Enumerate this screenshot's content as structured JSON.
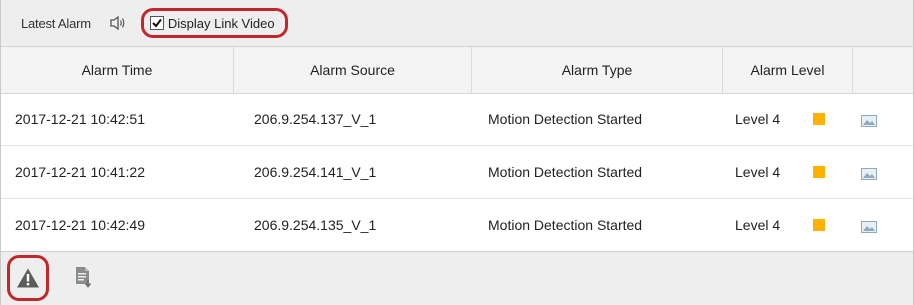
{
  "toolbar": {
    "title": "Latest Alarm",
    "sound_icon": "speaker-icon",
    "display_link_video_label": "Display Link Video",
    "display_link_video_checked": true
  },
  "table": {
    "columns": [
      "Alarm Time",
      "Alarm Source",
      "Alarm Type",
      "Alarm Level",
      ""
    ],
    "rows": [
      {
        "time": "2017-12-21 10:42:51",
        "source": "206.9.254.137_V_1",
        "type": "Motion Detection Started",
        "level": "Level 4",
        "level_color": "#ffb300",
        "snapshot_icon": "image-icon"
      },
      {
        "time": "2017-12-21 10:41:22",
        "source": "206.9.254.141_V_1",
        "type": "Motion Detection Started",
        "level": "Level 4",
        "level_color": "#ffb300",
        "snapshot_icon": "image-icon"
      },
      {
        "time": "2017-12-21 10:42:49",
        "source": "206.9.254.135_V_1",
        "type": "Motion Detection Started",
        "level": "Level 4",
        "level_color": "#ffb300",
        "snapshot_icon": "image-icon"
      }
    ]
  },
  "footer": {
    "alarm_icon": "warning-icon",
    "export_icon": "export-document-icon"
  },
  "colors": {
    "highlight": "#c0282d",
    "level4": "#ffb300"
  }
}
